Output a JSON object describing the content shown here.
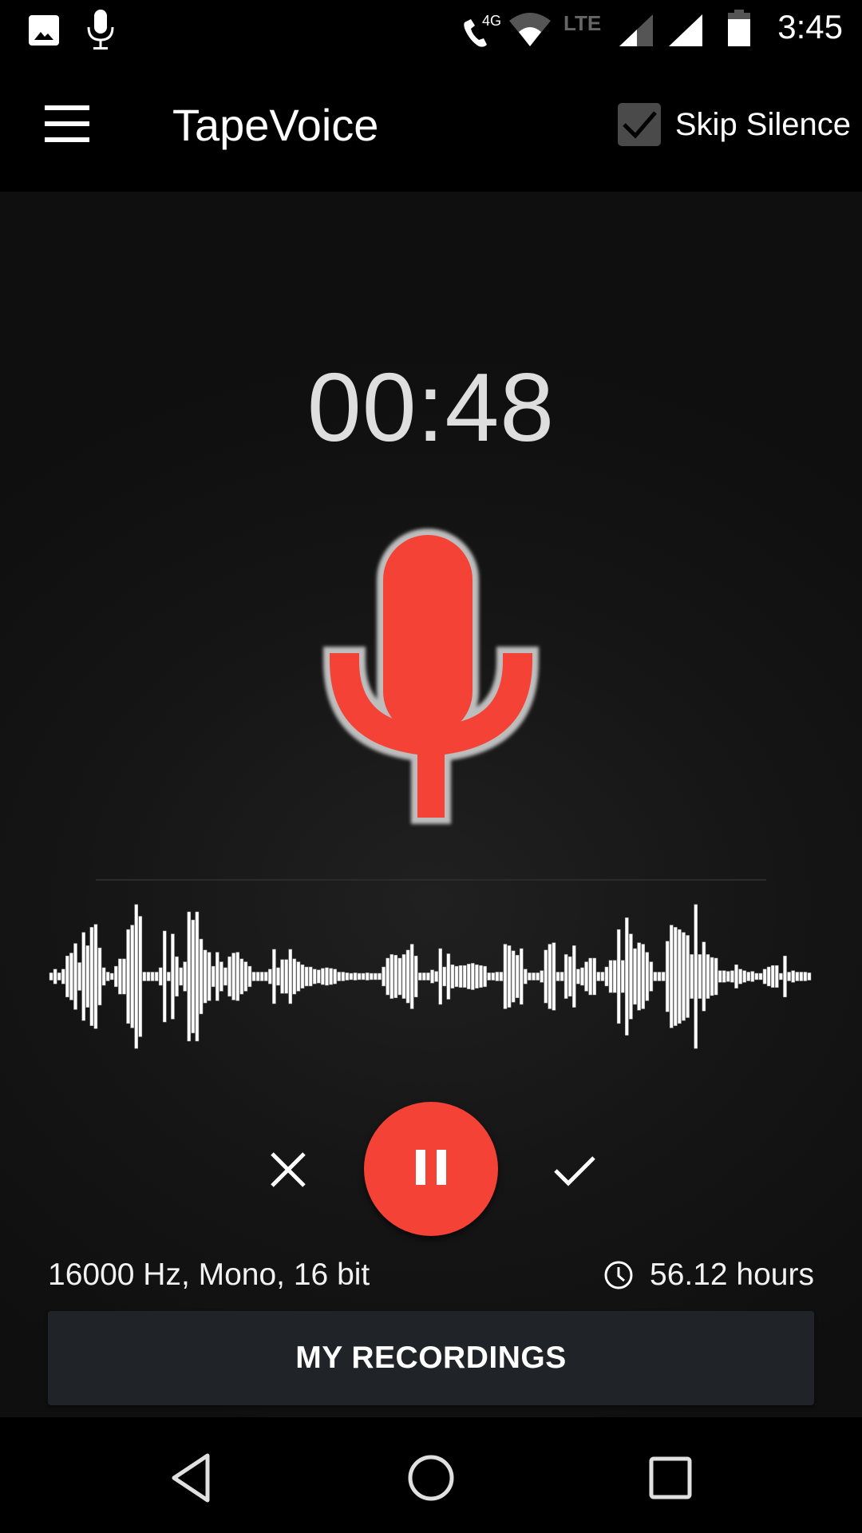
{
  "status_bar": {
    "time": "3:45",
    "left_icons": [
      "image-notification-icon",
      "microphone-notification-icon"
    ],
    "right_icons": [
      "wifi-calling-4g-icon",
      "wifi-icon",
      "lte-icon",
      "signal-icon",
      "signal-icon-2",
      "battery-icon"
    ],
    "call_label": "4G",
    "network_label": "LTE"
  },
  "app_bar": {
    "title": "TapeVoice",
    "menu_icon": "hamburger-menu-icon",
    "skip_silence": {
      "label": "Skip Silence",
      "checked": true
    }
  },
  "recorder": {
    "elapsed": "00:48",
    "state": "recording",
    "accent_color": "#f44336",
    "mic_icon": "microphone-icon",
    "format": "16000 Hz, Mono, 16 bit",
    "remaining": "56.12 hours",
    "remaining_icon": "clock-icon"
  },
  "controls": {
    "discard_icon": "close-icon",
    "pause_icon": "pause-icon",
    "save_icon": "check-icon"
  },
  "waveform": {
    "amplitudes": [
      0.05,
      0.1,
      0.05,
      0.1,
      0.28,
      0.32,
      0.45,
      0.19,
      0.6,
      0.42,
      0.67,
      0.71,
      0.39,
      0.12,
      0.06,
      0.04,
      0.14,
      0.24,
      0.24,
      0.64,
      0.7,
      0.98,
      0.82,
      0.06,
      0.06,
      0.06,
      0.06,
      0.12,
      0.62,
      0.06,
      0.58,
      0.27,
      0.12,
      0.2,
      0.88,
      0.77,
      0.88,
      0.51,
      0.36,
      0.33,
      0.14,
      0.33,
      0.2,
      0.12,
      0.27,
      0.32,
      0.33,
      0.24,
      0.2,
      0.14,
      0.06,
      0.06,
      0.06,
      0.06,
      0.1,
      0.37,
      0.12,
      0.23,
      0.23,
      0.37,
      0.24,
      0.2,
      0.16,
      0.13,
      0.13,
      0.1,
      0.09,
      0.11,
      0.12,
      0.11,
      0.1,
      0.06,
      0.06,
      0.05,
      0.04,
      0.05,
      0.04,
      0.04,
      0.05,
      0.04,
      0.04,
      0.04,
      0.13,
      0.25,
      0.3,
      0.29,
      0.25,
      0.3,
      0.36,
      0.44,
      0.28,
      0.05,
      0.05,
      0.05,
      0.09,
      0.07,
      0.38,
      0.13,
      0.31,
      0.16,
      0.14,
      0.15,
      0.15,
      0.17,
      0.18,
      0.16,
      0.15,
      0.14,
      0.05,
      0.05,
      0.06,
      0.06,
      0.44,
      0.42,
      0.35,
      0.29,
      0.38,
      0.1,
      0.05,
      0.05,
      0.05,
      0.08,
      0.36,
      0.44,
      0.46,
      0.06,
      0.06,
      0.3,
      0.27,
      0.42,
      0.1,
      0.12,
      0.2,
      0.25,
      0.25,
      0.06,
      0.06,
      0.13,
      0.22,
      0.22,
      0.64,
      0.22,
      0.8,
      0.58,
      0.38,
      0.46,
      0.44,
      0.33,
      0.2,
      0.06,
      0.06,
      0.06,
      0.48,
      0.7,
      0.67,
      0.64,
      0.6,
      0.56,
      0.3,
      0.98,
      0.3,
      0.47,
      0.3,
      0.26,
      0.25,
      0.08,
      0.08,
      0.07,
      0.08,
      0.16,
      0.1,
      0.08,
      0.06,
      0.07,
      0.04,
      0.04,
      0.1,
      0.13,
      0.15,
      0.15,
      0.04,
      0.28,
      0.06,
      0.08,
      0.06,
      0.06,
      0.06,
      0.05
    ],
    "bar_color": "#ffffff"
  },
  "bottom_button": {
    "label": "MY RECORDINGS"
  },
  "nav_bar": {
    "back_icon": "back-icon",
    "home_icon": "home-icon",
    "recents_icon": "recents-icon"
  }
}
